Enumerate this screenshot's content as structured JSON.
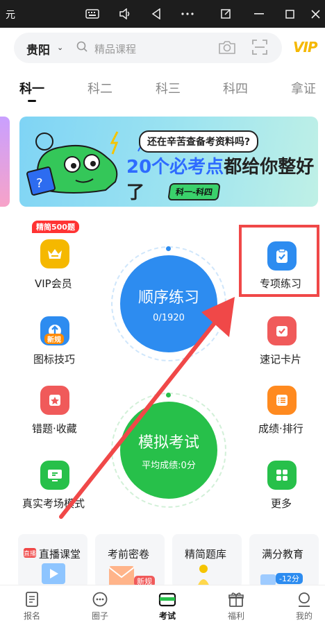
{
  "window": {
    "title": "元",
    "controls": [
      "keyboard-icon",
      "volume-icon",
      "back-icon",
      "more-icon",
      "resize-icon",
      "minimize-icon",
      "maximize-icon",
      "close-icon"
    ]
  },
  "header": {
    "city": "贵阳",
    "search_placeholder": "精品课程",
    "vip_label": "VIP"
  },
  "tabs": [
    {
      "label": "科一",
      "active": true
    },
    {
      "label": "科二",
      "active": false
    },
    {
      "label": "科三",
      "active": false
    },
    {
      "label": "科四",
      "active": false
    },
    {
      "label": "拿证",
      "active": false
    }
  ],
  "banner": {
    "question": "还在辛苦查备考资料吗?",
    "main_prefix": "20个必考点",
    "main_suffix": "都给你整好了",
    "tag": "科一-科四"
  },
  "left_items": [
    {
      "label": "VIP会员",
      "badge": "精简500题",
      "color": "#f5b800"
    },
    {
      "label": "图标技巧",
      "badge": "新规",
      "color": "#2d8cf0"
    },
    {
      "label": "错题·收藏",
      "badge": "",
      "color": "#f05a5a"
    },
    {
      "label": "真实考场模式",
      "badge": "",
      "color": "#27c04a"
    }
  ],
  "right_items": [
    {
      "label": "专项练习",
      "color": "#2d8cf0"
    },
    {
      "label": "速记卡片",
      "color": "#f05a5a"
    },
    {
      "label": "成绩·排行",
      "color": "#ff8a1f"
    },
    {
      "label": "更多",
      "color": "#27c04a"
    }
  ],
  "practice": {
    "title": "顺序练习",
    "progress": "0/1920"
  },
  "exam": {
    "title": "模拟考试",
    "sub": "平均成绩:0分"
  },
  "cards": [
    {
      "label": "直播课堂",
      "tag": "直播"
    },
    {
      "label": "考前密卷",
      "tag": "新规"
    },
    {
      "label": "精简题库",
      "tag": ""
    },
    {
      "label": "满分教育",
      "tag": "-12分"
    }
  ],
  "bottom_nav": [
    {
      "label": "报名",
      "active": false
    },
    {
      "label": "圈子",
      "active": false
    },
    {
      "label": "考试",
      "active": true
    },
    {
      "label": "福利",
      "active": false
    },
    {
      "label": "我的",
      "active": false
    }
  ],
  "colors": {
    "primary_blue": "#2d8cf0",
    "green": "#27c04a",
    "highlight_red": "#f04848"
  }
}
